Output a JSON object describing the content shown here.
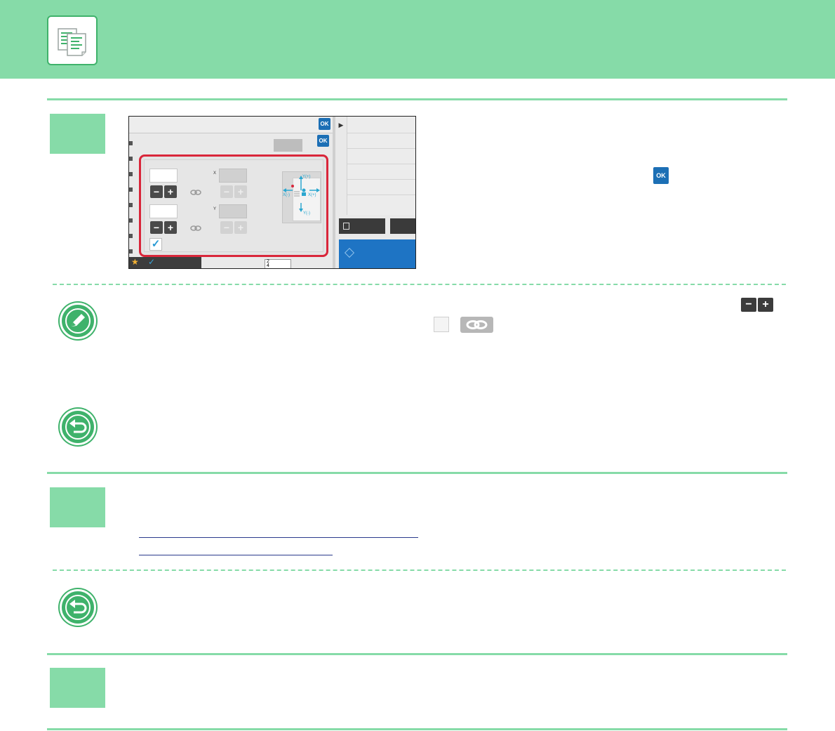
{
  "header": {
    "logo_icon": "copy-icon"
  },
  "step_badges": [
    {
      "icon": "step-badge"
    },
    {
      "icon": "step-badge"
    },
    {
      "icon": "step-badge"
    }
  ],
  "screenshot": {
    "ok_label": "OK",
    "minus_label": "−",
    "plus_label": "+",
    "x_label": "X",
    "y_label": "Y",
    "diagram_y_plus": "Y(+)",
    "diagram_y_minus": "Y(-)",
    "diagram_x_plus": "X(+)",
    "diagram_x_minus": "X(-)",
    "scale_top": "2",
    "scale_bottom": "4"
  },
  "inline_icons": {
    "ok_label": "OK",
    "minus_label": "−",
    "plus_label": "+"
  },
  "notes": {
    "pencil_icon": "pencil-icon",
    "return_icon": "return-icon"
  },
  "colors": {
    "brand_green": "#86dba8",
    "icon_green": "#3fb26b",
    "highlight_red": "#d9263a",
    "ok_blue": "#1c6fb5"
  }
}
